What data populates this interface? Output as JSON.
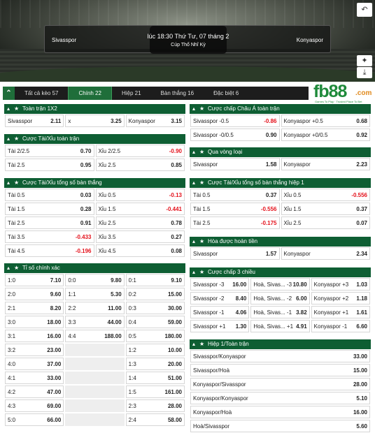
{
  "match": {
    "time": "lúc 18:30 Thứ Tư, 07 tháng 2",
    "league": "Cúp Thổ Nhĩ Kỳ",
    "home": "Sivasspor",
    "away": "Konyaspor"
  },
  "banner_icons": [
    "back-icon",
    "pin-icon",
    "download-icon"
  ],
  "tabs": [
    {
      "label": "Tất cả kèo 57"
    },
    {
      "label": "Chính 22"
    },
    {
      "label": "Hiệp 21"
    },
    {
      "label": "Bàn thắng 16"
    },
    {
      "label": "Đặc biệt 6"
    }
  ],
  "logo": {
    "text": "fb88",
    "domain": ".com",
    "tagline": "Games To Play · Trusted Place To Bet"
  },
  "panels": {
    "fulltime_1x2": {
      "title": "Toàn trận 1X2",
      "rows": [
        [
          {
            "l": "Sivasspor",
            "o": "2.11"
          },
          {
            "l": "x",
            "o": "3.25"
          },
          {
            "l": "Konyaspor",
            "o": "3.15"
          }
        ]
      ]
    },
    "ou_fulltime": {
      "title": "Cược Tài/Xỉu toàn trận",
      "rows": [
        [
          {
            "l": "Tài 2/2.5",
            "o": "0.70"
          },
          {
            "l": "Xỉu 2/2.5",
            "o": "-0.90"
          }
        ],
        [
          {
            "l": "Tài 2.5",
            "o": "0.95"
          },
          {
            "l": "Xỉu 2.5",
            "o": "0.85"
          }
        ]
      ]
    },
    "ou_total": {
      "title": "Cược Tài/Xỉu tổng số bàn thắng",
      "rows": [
        [
          {
            "l": "Tài 0.5",
            "o": "0.03"
          },
          {
            "l": "Xỉu 0.5",
            "o": "-0.13"
          }
        ],
        [
          {
            "l": "Tài 1.5",
            "o": "0.28"
          },
          {
            "l": "Xỉu 1.5",
            "o": "-0.441"
          }
        ],
        [
          {
            "l": "Tài 2.5",
            "o": "0.91"
          },
          {
            "l": "Xỉu 2.5",
            "o": "0.78"
          }
        ],
        [
          {
            "l": "Tài 3.5",
            "o": "-0.433"
          },
          {
            "l": "Xỉu 3.5",
            "o": "0.27"
          }
        ],
        [
          {
            "l": "Tài 4.5",
            "o": "-0.196"
          },
          {
            "l": "Xỉu 4.5",
            "o": "0.08"
          }
        ]
      ]
    },
    "correct_score": {
      "title": "Tỉ số chính xác",
      "rows": [
        [
          {
            "l": "1:0",
            "o": "7.10"
          },
          {
            "l": "0:0",
            "o": "9.80"
          },
          {
            "l": "0:1",
            "o": "9.10"
          }
        ],
        [
          {
            "l": "2:0",
            "o": "9.60"
          },
          {
            "l": "1:1",
            "o": "5.30"
          },
          {
            "l": "0:2",
            "o": "15.00"
          }
        ],
        [
          {
            "l": "2:1",
            "o": "8.20"
          },
          {
            "l": "2:2",
            "o": "11.00"
          },
          {
            "l": "0:3",
            "o": "30.00"
          }
        ],
        [
          {
            "l": "3:0",
            "o": "18.00"
          },
          {
            "l": "3:3",
            "o": "44.00"
          },
          {
            "l": "0:4",
            "o": "59.00"
          }
        ],
        [
          {
            "l": "3:1",
            "o": "16.00"
          },
          {
            "l": "4:4",
            "o": "188.00"
          },
          {
            "l": "0:5",
            "o": "180.00"
          }
        ],
        [
          {
            "l": "3:2",
            "o": "23.00"
          },
          null,
          {
            "l": "1:2",
            "o": "10.00"
          }
        ],
        [
          {
            "l": "4:0",
            "o": "37.00"
          },
          null,
          {
            "l": "1:3",
            "o": "20.00"
          }
        ],
        [
          {
            "l": "4:1",
            "o": "33.00"
          },
          null,
          {
            "l": "1:4",
            "o": "51.00"
          }
        ],
        [
          {
            "l": "4:2",
            "o": "47.00"
          },
          null,
          {
            "l": "1:5",
            "o": "161.00"
          }
        ],
        [
          {
            "l": "4:3",
            "o": "69.00"
          },
          null,
          {
            "l": "2:3",
            "o": "28.00"
          }
        ],
        [
          {
            "l": "5:0",
            "o": "66.00"
          },
          null,
          {
            "l": "2:4",
            "o": "58.00"
          }
        ]
      ]
    },
    "asian_handicap": {
      "title": "Cược chấp Châu Á toàn trận",
      "rows": [
        [
          {
            "l": "Sivasspor -0.5",
            "o": "-0.86"
          },
          {
            "l": "Konyaspor +0.5",
            "o": "0.68"
          }
        ],
        [
          {
            "l": "Sivasspor -0/0.5",
            "o": "0.90"
          },
          {
            "l": "Konyaspor +0/0.5",
            "o": "0.92"
          }
        ]
      ]
    },
    "to_qualify": {
      "title": "Qua vòng loại",
      "rows": [
        [
          {
            "l": "Sivasspor",
            "o": "1.58"
          },
          {
            "l": "Konyaspor",
            "o": "2.23"
          }
        ]
      ]
    },
    "ou_first_half": {
      "title": "Cược Tài/Xỉu tổng số bàn thắng hiệp 1",
      "rows": [
        [
          {
            "l": "Tài 0.5",
            "o": "0.37"
          },
          {
            "l": "Xỉu 0.5",
            "o": "-0.556"
          }
        ],
        [
          {
            "l": "Tài 1.5",
            "o": "-0.556"
          },
          {
            "l": "Xỉu 1.5",
            "o": "0.37"
          }
        ],
        [
          {
            "l": "Tài 2.5",
            "o": "-0.175"
          },
          {
            "l": "Xỉu 2.5",
            "o": "0.07"
          }
        ]
      ]
    },
    "draw_no_bet": {
      "title": "Hòa được hoàn tiền",
      "rows": [
        [
          {
            "l": "Sivasspor",
            "o": "1.57"
          },
          {
            "l": "Konyaspor",
            "o": "2.34"
          }
        ]
      ]
    },
    "three_way_handicap": {
      "title": "Cược chấp 3 chiều",
      "rows": [
        [
          {
            "l": "Sivasspor -3",
            "o": "16.00"
          },
          {
            "l": "Hoà, Sivas... -3",
            "o": "10.80"
          },
          {
            "l": "Konyaspor +3",
            "o": "1.03"
          }
        ],
        [
          {
            "l": "Sivasspor -2",
            "o": "8.40"
          },
          {
            "l": "Hoà, Sivas... -2",
            "o": "6.00"
          },
          {
            "l": "Konyaspor +2",
            "o": "1.18"
          }
        ],
        [
          {
            "l": "Sivasspor -1",
            "o": "4.06"
          },
          {
            "l": "Hoà, Sivas... -1",
            "o": "3.82"
          },
          {
            "l": "Konyaspor +1",
            "o": "1.61"
          }
        ],
        [
          {
            "l": "Sivasspor +1",
            "o": "1.30"
          },
          {
            "l": "Hoà, Sivas... +1",
            "o": "4.91"
          },
          {
            "l": "Konyaspor -1",
            "o": "6.60"
          }
        ]
      ]
    },
    "ht_ft": {
      "title": "Hiệp 1/Toàn trận",
      "rows": [
        [
          {
            "l": "Sivasspor/Konyaspor",
            "o": "33.00"
          }
        ],
        [
          {
            "l": "Sivasspor/Hoà",
            "o": "15.00"
          }
        ],
        [
          {
            "l": "Konyaspor/Sivasspor",
            "o": "28.00"
          }
        ],
        [
          {
            "l": "Konyaspor/Konyaspor",
            "o": "5.10"
          }
        ],
        [
          {
            "l": "Konyaspor/Hoà",
            "o": "16.00"
          }
        ],
        [
          {
            "l": "Hoà/Sivasspor",
            "o": "5.60"
          }
        ]
      ]
    }
  },
  "colors": {
    "header_green": "#0e5e33",
    "negative_odds": "#e4111b",
    "tab_active": "#1f6e3a"
  }
}
